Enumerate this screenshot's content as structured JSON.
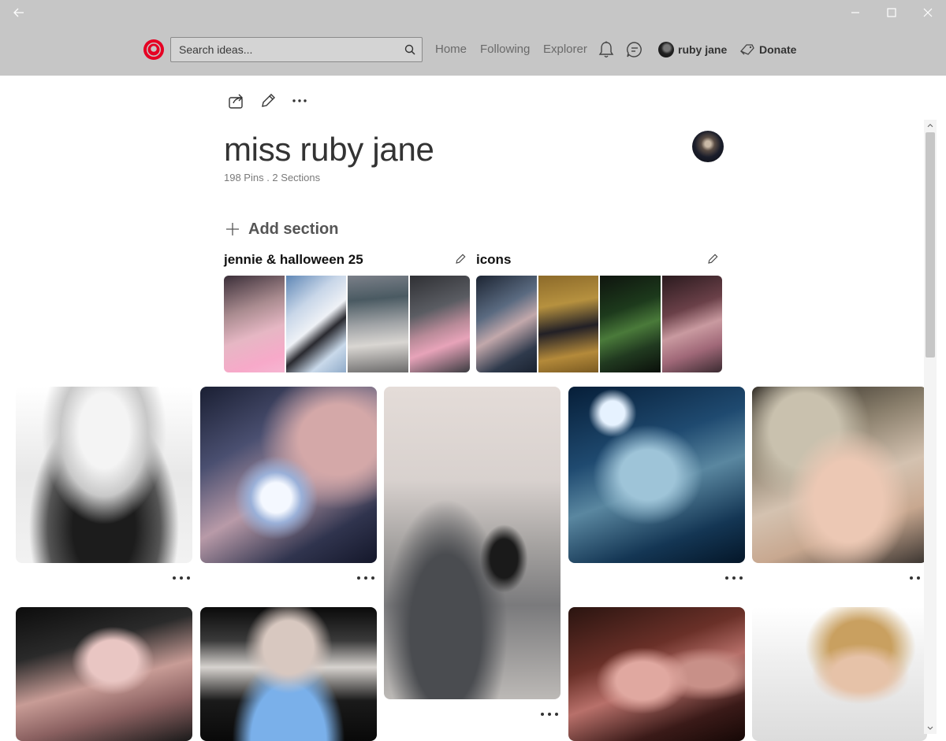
{
  "window": {
    "back_icon": "arrow-left-icon",
    "controls": [
      "minimize-icon",
      "maximize-icon",
      "close-icon"
    ]
  },
  "header": {
    "logo_icon": "app-logo-icon",
    "search": {
      "placeholder": "Search ideas...",
      "value": ""
    },
    "nav": {
      "home": "Home",
      "following": "Following",
      "explorer": "Explorer"
    },
    "notifications_icon": "bell-icon",
    "messages_icon": "chat-icon",
    "user_name": "ruby jane",
    "donate_label": "Donate",
    "accent_color": "#e60023"
  },
  "board": {
    "title": "miss ruby jane",
    "meta": "198 Pins . 2 Sections",
    "add_section_label": "Add section",
    "sections": [
      {
        "title": "jennie & halloween 25",
        "thumb_count": 4
      },
      {
        "title": "icons",
        "thumb_count": 4
      }
    ]
  },
  "pins": [
    "photo",
    "photo",
    "photo",
    "photo",
    "photo",
    "photo",
    "photo",
    "photo",
    "photo"
  ]
}
